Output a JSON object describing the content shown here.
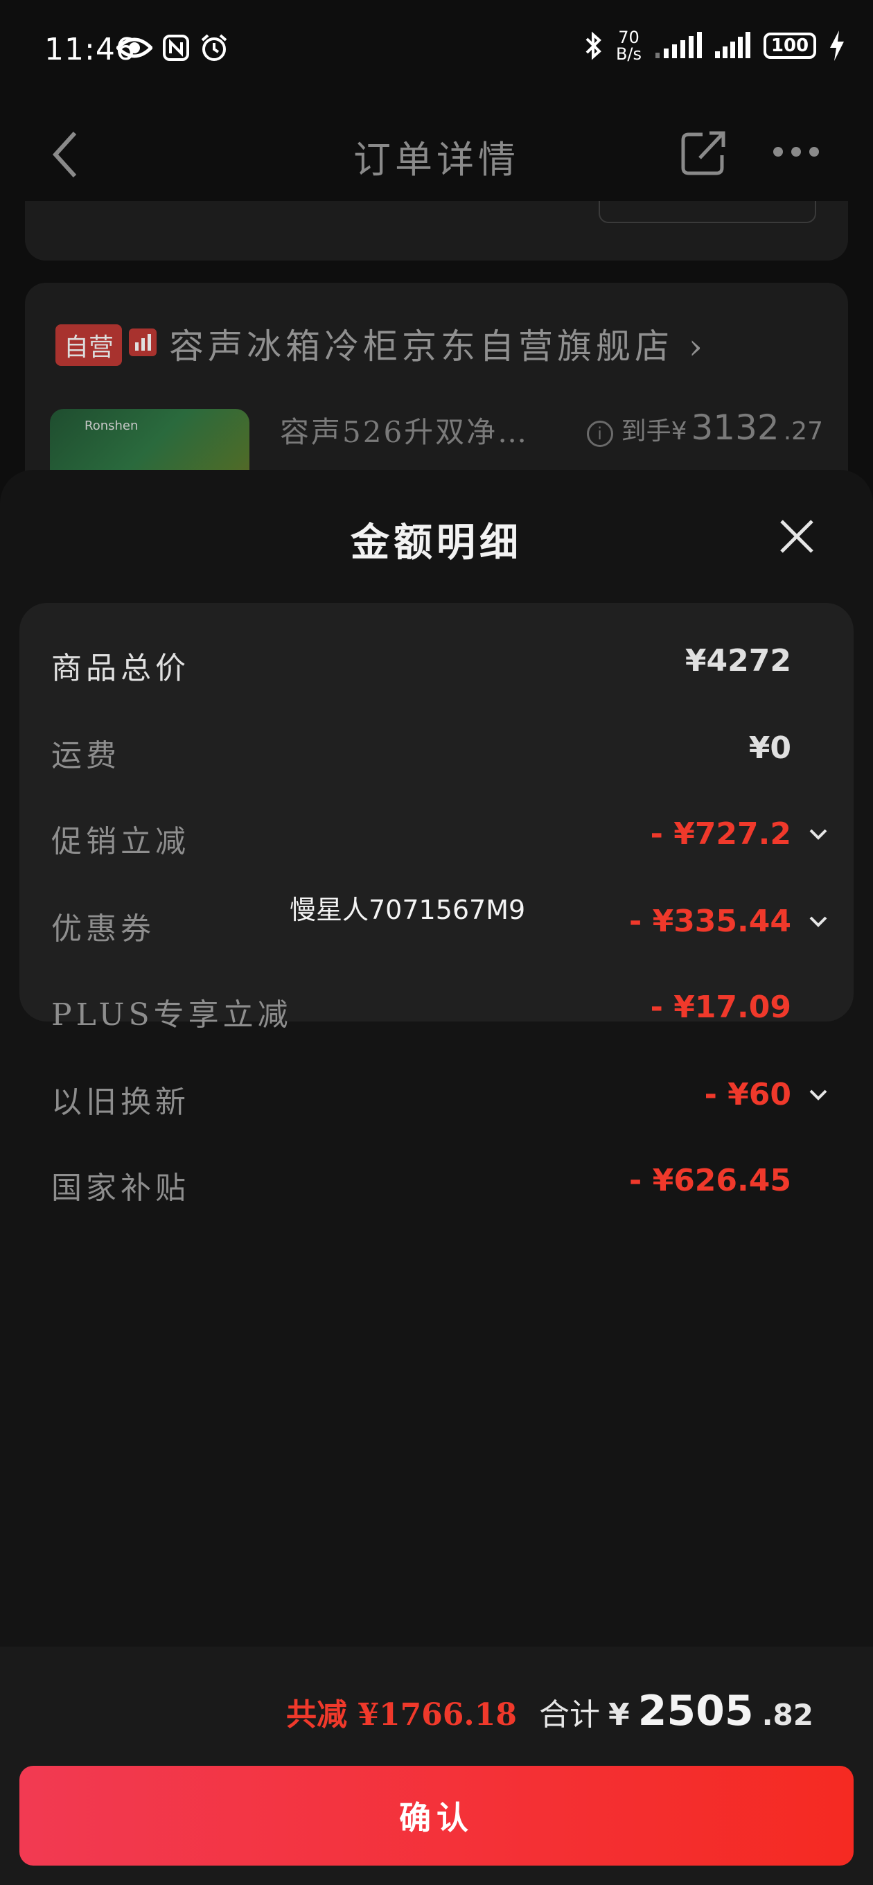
{
  "status_bar": {
    "time": "11:46",
    "net_speed_value": "70",
    "net_speed_unit": "B/s",
    "battery": "100"
  },
  "header": {
    "title": "订单详情"
  },
  "store": {
    "self_badge": "自营",
    "name": "容声冰箱冷柜京东自营旗舰店",
    "chevron": "›"
  },
  "product": {
    "image_brand": "Ronshen",
    "name": "容声526升双净…",
    "price_prefix": "到手¥",
    "price_int": "3132",
    "price_dec": ".27"
  },
  "sheet": {
    "title": "金额明细",
    "rows": [
      {
        "label": "商品总价",
        "value": "¥4272"
      },
      {
        "label": "运费",
        "value": "¥0"
      },
      {
        "label": "促销立减",
        "value": "- ¥727.2"
      },
      {
        "label": "优惠券",
        "value": "- ¥335.44"
      },
      {
        "label": "PLUS专享立减",
        "value": "- ¥17.09"
      },
      {
        "label": "以旧换新",
        "value": "- ¥60"
      },
      {
        "label": "国家补贴",
        "value": "- ¥626.45"
      }
    ],
    "watermark": "慢星人7071567M9"
  },
  "footer": {
    "reduce_text": "共减 ¥1766.18",
    "total_label": "合计",
    "total_yen": "¥",
    "total_int": "2505",
    "total_dec": ".82",
    "confirm_label": "确认"
  },
  "colors": {
    "accent_red": "#f0392b",
    "button_gradient_start": "#f23a52",
    "button_gradient_end": "#f52a22"
  }
}
